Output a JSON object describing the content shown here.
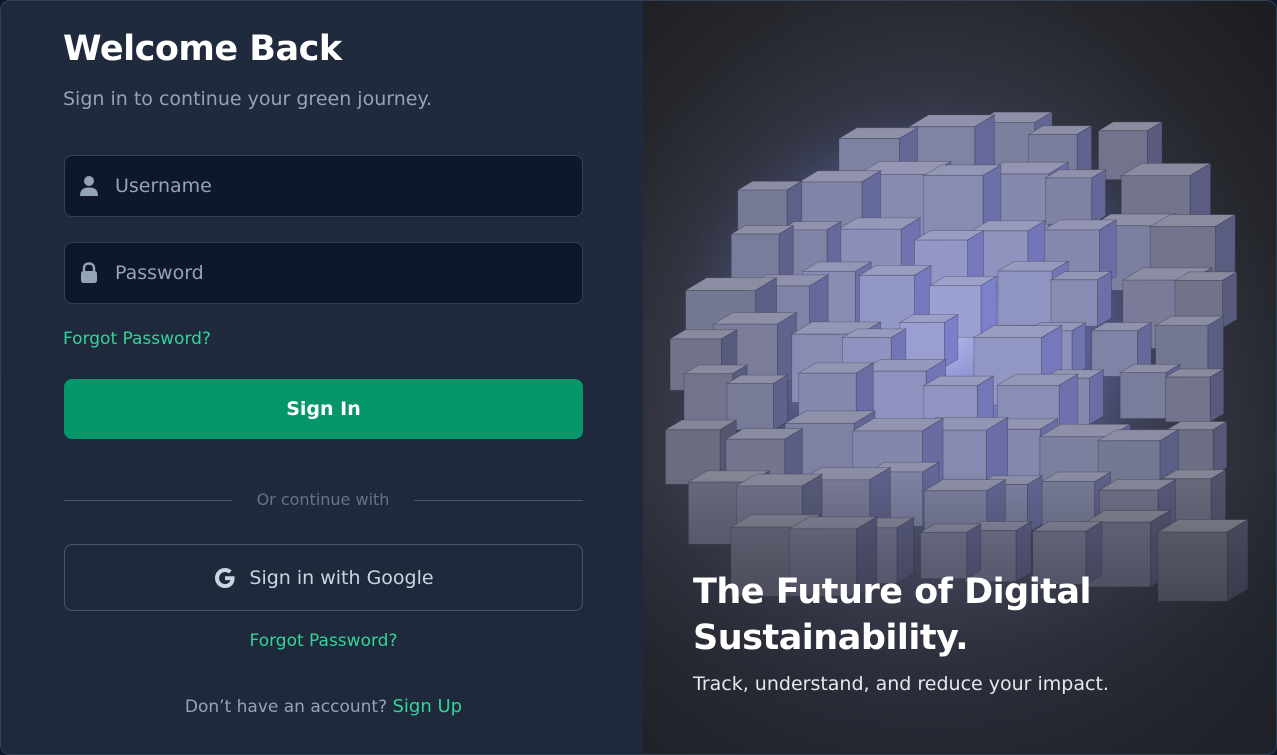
{
  "login": {
    "title": "Welcome Back",
    "subtitle": "Sign in to continue your green journey.",
    "username_placeholder": "Username",
    "password_placeholder": "Password",
    "forgot_password_top": "Forgot Password?",
    "sign_in_label": "Sign In",
    "divider_text": "Or continue with",
    "google_label": "Sign in with Google",
    "forgot_password_bottom": "Forgot Password?",
    "no_account_text": "Don’t have an account?",
    "sign_up_label": "Sign Up"
  },
  "hero": {
    "title": "The Future of Digital Sustainability.",
    "subtitle": "Track, understand, and reduce your impact."
  },
  "colors": {
    "accent": "#059669",
    "link": "#34d399",
    "panel": "#1e293b",
    "input_bg": "#0f172a"
  },
  "icons": {
    "username": "user-icon",
    "password": "lock-icon",
    "google": "google-icon"
  }
}
